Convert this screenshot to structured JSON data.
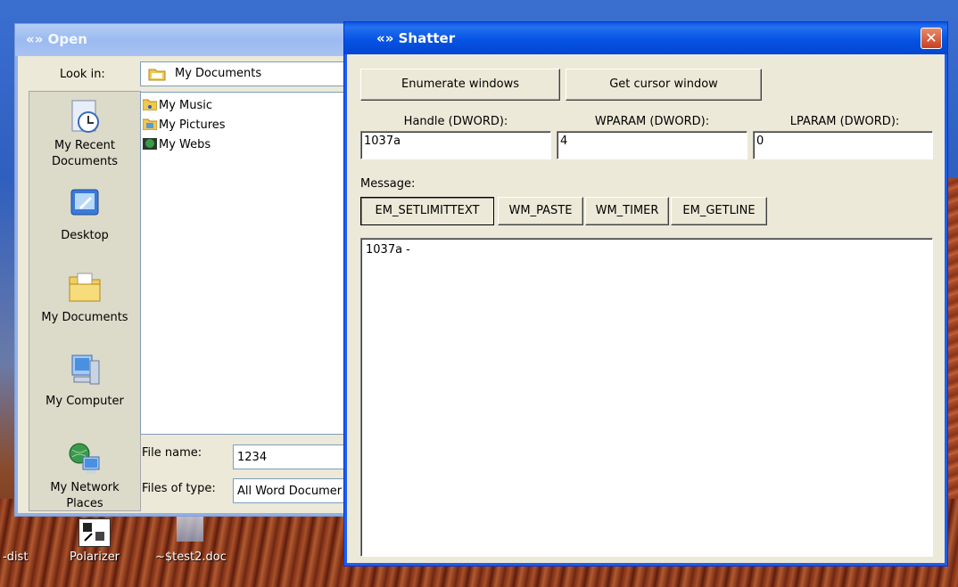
{
  "desktop": {
    "icons": [
      {
        "label": "-dist"
      },
      {
        "label": "Polarizer"
      },
      {
        "label": "~$test2.doc"
      }
    ]
  },
  "open_dialog": {
    "title": "«» Open",
    "look_in_label": "Look in:",
    "look_in_value": "My Documents",
    "places": [
      {
        "label": "My Recent Documents",
        "icon": "recent-documents-icon"
      },
      {
        "label": "Desktop",
        "icon": "desktop-icon"
      },
      {
        "label": "My Documents",
        "icon": "my-documents-icon"
      },
      {
        "label": "My Computer",
        "icon": "my-computer-icon"
      },
      {
        "label": "My Network Places",
        "icon": "network-places-icon"
      }
    ],
    "files": [
      {
        "name": "My Music",
        "icon": "music-folder-icon"
      },
      {
        "name": "My Pictures",
        "icon": "pictures-folder-icon"
      },
      {
        "name": "My Webs",
        "icon": "webs-folder-icon"
      }
    ],
    "file_name_label": "File name:",
    "file_name_value": "1234",
    "file_type_label": "Files of type:",
    "file_type_value": "All Word Documer"
  },
  "shatter": {
    "title": "«» Shatter",
    "close": "✕",
    "enum_button": "Enumerate windows",
    "cursor_button": "Get cursor window",
    "handle_label": "Handle (DWORD):",
    "wparam_label": "WPARAM (DWORD):",
    "lparam_label": "LPARAM (DWORD):",
    "handle_value": "1037a",
    "wparam_value": "4",
    "lparam_value": "0",
    "message_label": "Message:",
    "messages": [
      "EM_SETLIMITTEXT",
      "WM_PASTE",
      "WM_TIMER",
      "EM_GETLINE"
    ],
    "output": "1037a -"
  },
  "colors": {
    "xp_blue": "#0553e3",
    "dialog_face": "#ece9d8",
    "close_red": "#c8401f"
  }
}
